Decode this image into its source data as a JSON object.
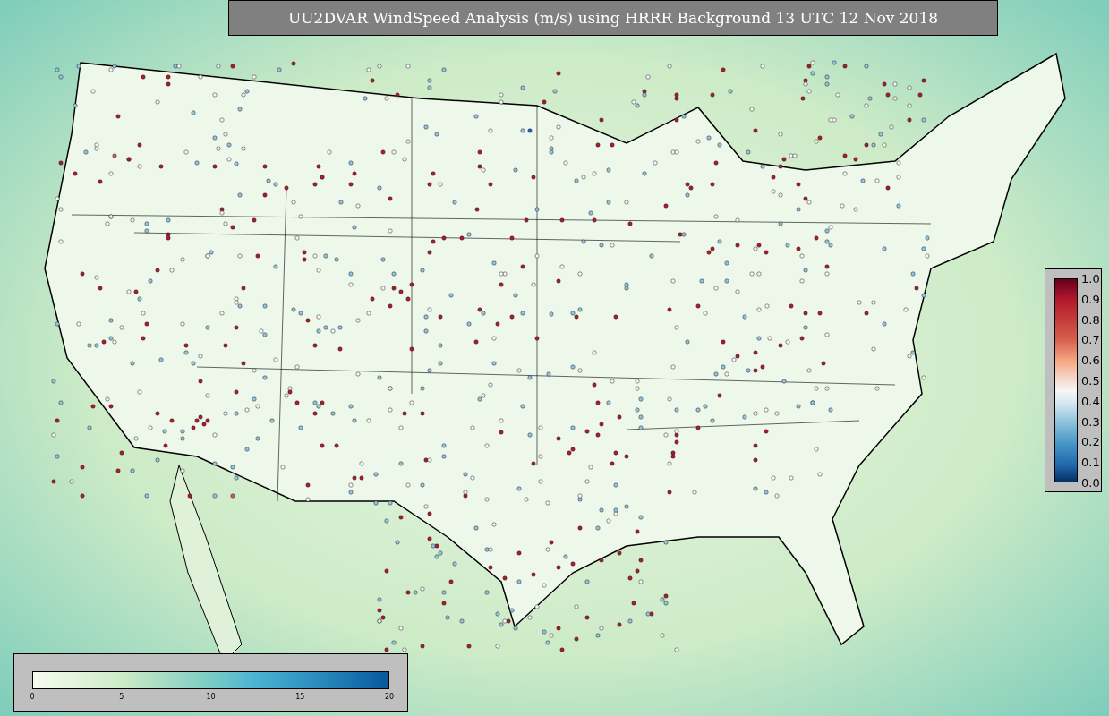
{
  "title": "UU2DVAR WindSpeed Analysis (m/s) using HRRR Background 13 UTC 12 Nov 2018",
  "vertical_colorbar": {
    "ticks": [
      "1.0",
      "0.9",
      "0.8",
      "0.7",
      "0.6",
      "0.5",
      "0.4",
      "0.3",
      "0.2",
      "0.1",
      "0.0"
    ]
  },
  "horizontal_colorbar": {
    "ticks": [
      "0",
      "5",
      "10",
      "15",
      "20"
    ]
  }
}
